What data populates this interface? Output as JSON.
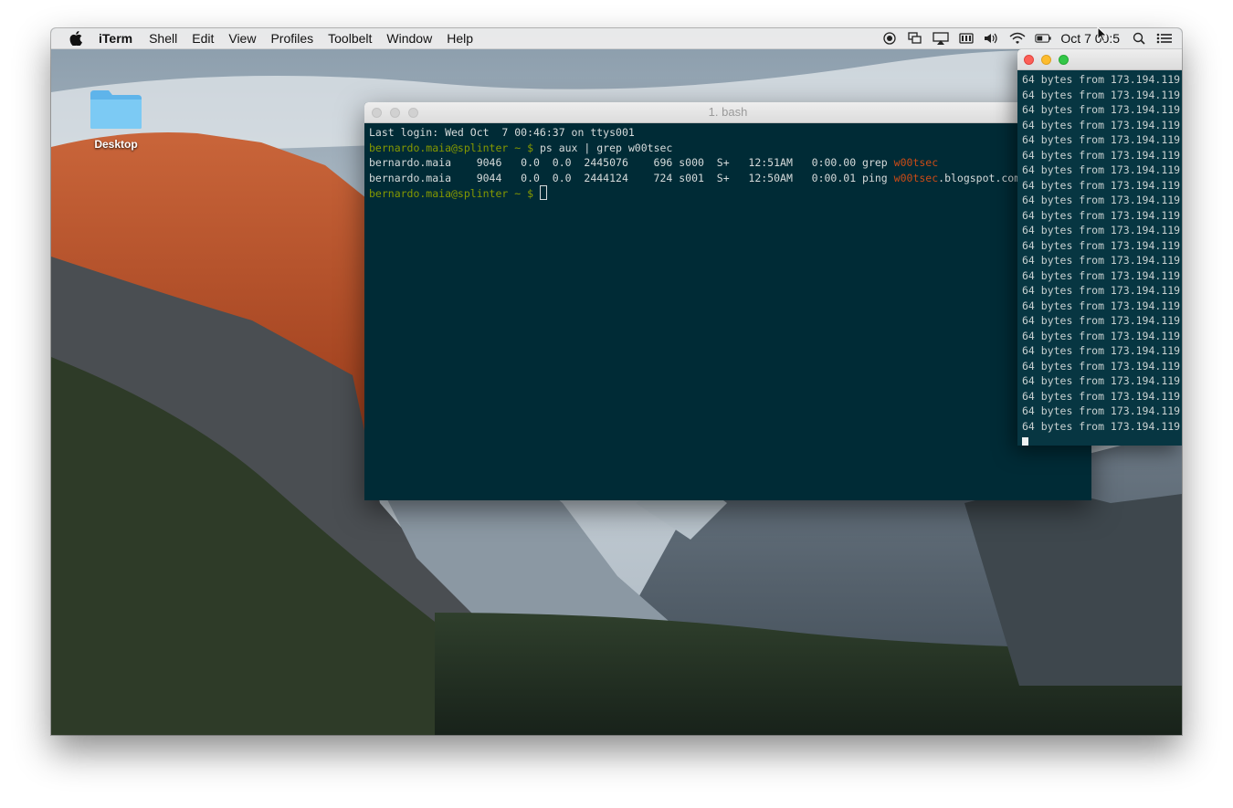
{
  "menubar": {
    "app": "iTerm",
    "items": [
      "Shell",
      "Edit",
      "View",
      "Profiles",
      "Toolbelt",
      "Window",
      "Help"
    ],
    "clock": "Oct 7  00:5",
    "status_icons": [
      "record-icon",
      "display-mirror-icon",
      "airplay-icon",
      "memory-icon",
      "volume-icon",
      "wifi-icon",
      "battery-icon",
      "spotlight-icon",
      "notification-center-icon"
    ]
  },
  "desktop": {
    "icon_label": "Desktop"
  },
  "terminal": {
    "title": "1. bash",
    "last_login": "Last login: Wed Oct  7 00:46:37 on ttys001",
    "prompt": "bernardo.maia@splinter ~ $",
    "command": " ps aux | grep w00tsec",
    "rows": [
      {
        "pre": "bernardo.maia    9046   0.0  0.0  2445076    696 s000  S+   12:51AM   0:00.00 grep ",
        "match": "w00tsec",
        "post": ""
      },
      {
        "pre": "bernardo.maia    9044   0.0  0.0  2444124    724 s001  S+   12:50AM   0:00.01 ping ",
        "match": "w00tsec",
        "post": ".blogspot.com"
      }
    ]
  },
  "ping": {
    "lines": [
      "64 bytes from 173.194.119.",
      "64 bytes from 173.194.119.",
      "64 bytes from 173.194.119.",
      "64 bytes from 173.194.119.",
      "64 bytes from 173.194.119.",
      "64 bytes from 173.194.119.",
      "64 bytes from 173.194.119.",
      "64 bytes from 173.194.119.",
      "64 bytes from 173.194.119.",
      "64 bytes from 173.194.119.",
      "64 bytes from 173.194.119.",
      "64 bytes from 173.194.119.",
      "64 bytes from 173.194.119.",
      "64 bytes from 173.194.119.",
      "64 bytes from 173.194.119.",
      "64 bytes from 173.194.119.",
      "64 bytes from 173.194.119.",
      "64 bytes from 173.194.119.",
      "64 bytes from 173.194.119.",
      "64 bytes from 173.194.119.",
      "64 bytes from 173.194.119.",
      "64 bytes from 173.194.119.",
      "64 bytes from 173.194.119.",
      "64 bytes from 173.194.119."
    ]
  },
  "colors": {
    "terminal_bg": "#002b36",
    "prompt": "#859900",
    "highlight": "#cb4b16",
    "close": "#fc5f57",
    "minimize": "#fdbc2e",
    "zoom": "#33c748"
  }
}
